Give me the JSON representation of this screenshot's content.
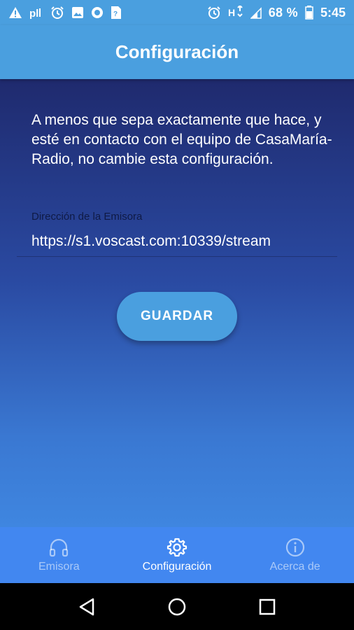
{
  "status_bar": {
    "battery": "68 %",
    "time": "5:45",
    "left_icons": [
      "warning-icon",
      "signal-icon",
      "alarm-icon",
      "image-icon",
      "record-icon",
      "sim-icon"
    ],
    "right_icons": [
      "alarm-icon",
      "network-icon",
      "signal-icon",
      "battery-icon"
    ]
  },
  "app_bar": {
    "title": "Configuración"
  },
  "main": {
    "warning_text": "A menos que sepa exactamente que hace, y esté en contacto con el equipo de CasaMaría-Radio, no cambie esta configuración.",
    "field_label": "Dirección de la Emisora",
    "field_value": "https://s1.voscast.com:10339/stream",
    "save_label": "GUARDAR"
  },
  "bottom_nav": {
    "items": [
      {
        "label": "Emisora",
        "icon": "headphones-icon",
        "active": false
      },
      {
        "label": "Configuración",
        "icon": "gear-icon",
        "active": true
      },
      {
        "label": "Acerca de",
        "icon": "info-icon",
        "active": false
      }
    ]
  },
  "colors": {
    "primary": "#4a9fdf",
    "nav": "#4287f0",
    "gradient_top": "#1f2a6e",
    "gradient_bottom": "#3f86e0"
  }
}
